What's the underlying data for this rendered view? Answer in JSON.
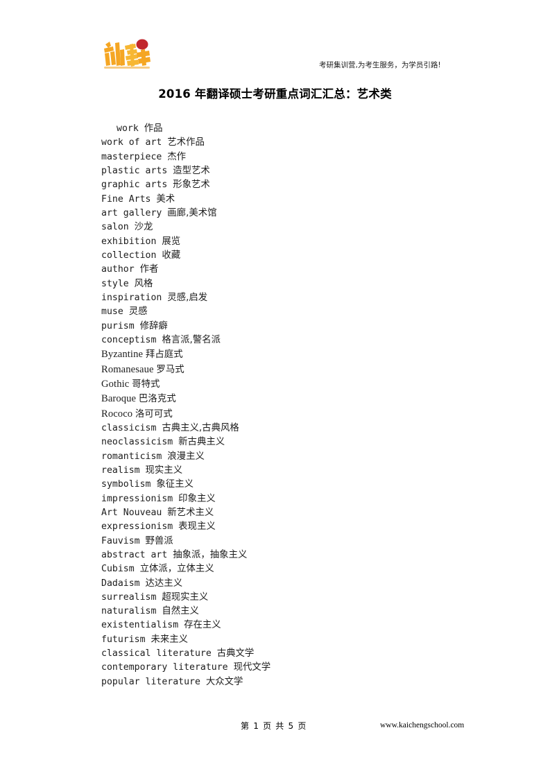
{
  "header": {
    "logo_name": "kaicheng-logo",
    "logo_text": "凯程",
    "logo_colors": {
      "primary": "#F5A623",
      "accent": "#F7C948",
      "dot": "#C1272D"
    },
    "tagline": "考研集训营,为考生服务，为学员引路!"
  },
  "title": "2016 年翻译硕士考研重点词汇汇总：艺术类",
  "lines": [
    {
      "en": "work",
      "cn": "作品",
      "indent": true,
      "serif": false
    },
    {
      "en": "work of art",
      "cn": "艺术作品",
      "indent": false,
      "serif": false
    },
    {
      "en": "masterpiece",
      "cn": "杰作",
      "indent": false,
      "serif": false
    },
    {
      "en": "plastic arts",
      "cn": "造型艺术",
      "indent": false,
      "serif": false
    },
    {
      "en": "graphic arts",
      "cn": "形象艺术",
      "indent": false,
      "serif": false
    },
    {
      "en": "Fine Arts",
      "cn": "美术",
      "indent": false,
      "serif": false
    },
    {
      "en": "art gallery",
      "cn": "画廊,美术馆",
      "indent": false,
      "serif": false
    },
    {
      "en": "salon",
      "cn": "沙龙",
      "indent": false,
      "serif": false
    },
    {
      "en": "exhibition",
      "cn": "展览",
      "indent": false,
      "serif": false
    },
    {
      "en": "collection",
      "cn": "收藏",
      "indent": false,
      "serif": false
    },
    {
      "en": "author",
      "cn": "作者",
      "indent": false,
      "serif": false
    },
    {
      "en": "style",
      "cn": "风格",
      "indent": false,
      "serif": false
    },
    {
      "en": "inspiration",
      "cn": "灵感,启发",
      "indent": false,
      "serif": false
    },
    {
      "en": "muse",
      "cn": "灵感",
      "indent": false,
      "serif": false
    },
    {
      "en": "purism",
      "cn": "修辞癖",
      "indent": false,
      "serif": false
    },
    {
      "en": "conceptism",
      "cn": "格言派,警名派",
      "indent": false,
      "serif": false
    },
    {
      "en": "Byzantine",
      "cn": "拜占庭式",
      "indent": false,
      "serif": true
    },
    {
      "en": "Romanesaue",
      "cn": "罗马式",
      "indent": false,
      "serif": true
    },
    {
      "en": "Gothic",
      "cn": "哥特式",
      "indent": false,
      "serif": true
    },
    {
      "en": "Baroque",
      "cn": "巴洛克式",
      "indent": false,
      "serif": true
    },
    {
      "en": "Rococo",
      "cn": "洛可可式",
      "indent": false,
      "serif": true
    },
    {
      "en": "classicism",
      "cn": "古典主义,古典风格",
      "indent": false,
      "serif": false
    },
    {
      "en": "neoclassicism",
      "cn": "新古典主义",
      "indent": false,
      "serif": false
    },
    {
      "en": "romanticism",
      "cn": "浪漫主义",
      "indent": false,
      "serif": false
    },
    {
      "en": "realism",
      "cn": "现实主义",
      "indent": false,
      "serif": false
    },
    {
      "en": "symbolism",
      "cn": "象征主义",
      "indent": false,
      "serif": false
    },
    {
      "en": "impressionism",
      "cn": "印象主义",
      "indent": false,
      "serif": false
    },
    {
      "en": "Art Nouveau",
      "cn": "新艺术主义",
      "indent": false,
      "serif": false
    },
    {
      "en": "expressionism",
      "cn": "表现主义",
      "indent": false,
      "serif": false
    },
    {
      "en": "Fauvism",
      "cn": "野兽派",
      "indent": false,
      "serif": false
    },
    {
      "en": "abstract art",
      "cn": "抽象派，抽象主义",
      "indent": false,
      "serif": false
    },
    {
      "en": "Cubism",
      "cn": "立体派，立体主义",
      "indent": false,
      "serif": false
    },
    {
      "en": "Dadaism",
      "cn": "达达主义",
      "indent": false,
      "serif": false
    },
    {
      "en": "surrealism",
      "cn": "超现实主义",
      "indent": false,
      "serif": false
    },
    {
      "en": "naturalism",
      "cn": "自然主义",
      "indent": false,
      "serif": false
    },
    {
      "en": "existentialism",
      "cn": "存在主义",
      "indent": false,
      "serif": false
    },
    {
      "en": "futurism",
      "cn": "未来主义",
      "indent": false,
      "serif": false
    },
    {
      "en": "classical literature",
      "cn": "古典文学",
      "indent": false,
      "serif": false
    },
    {
      "en": "contemporary literature",
      "cn": "现代文学",
      "indent": false,
      "serif": false
    },
    {
      "en": "popular literature",
      "cn": "大众文学",
      "indent": false,
      "serif": false
    }
  ],
  "footer": {
    "page_indicator": "第 1 页 共 5 页",
    "website": "www.kaichengschool.com"
  }
}
